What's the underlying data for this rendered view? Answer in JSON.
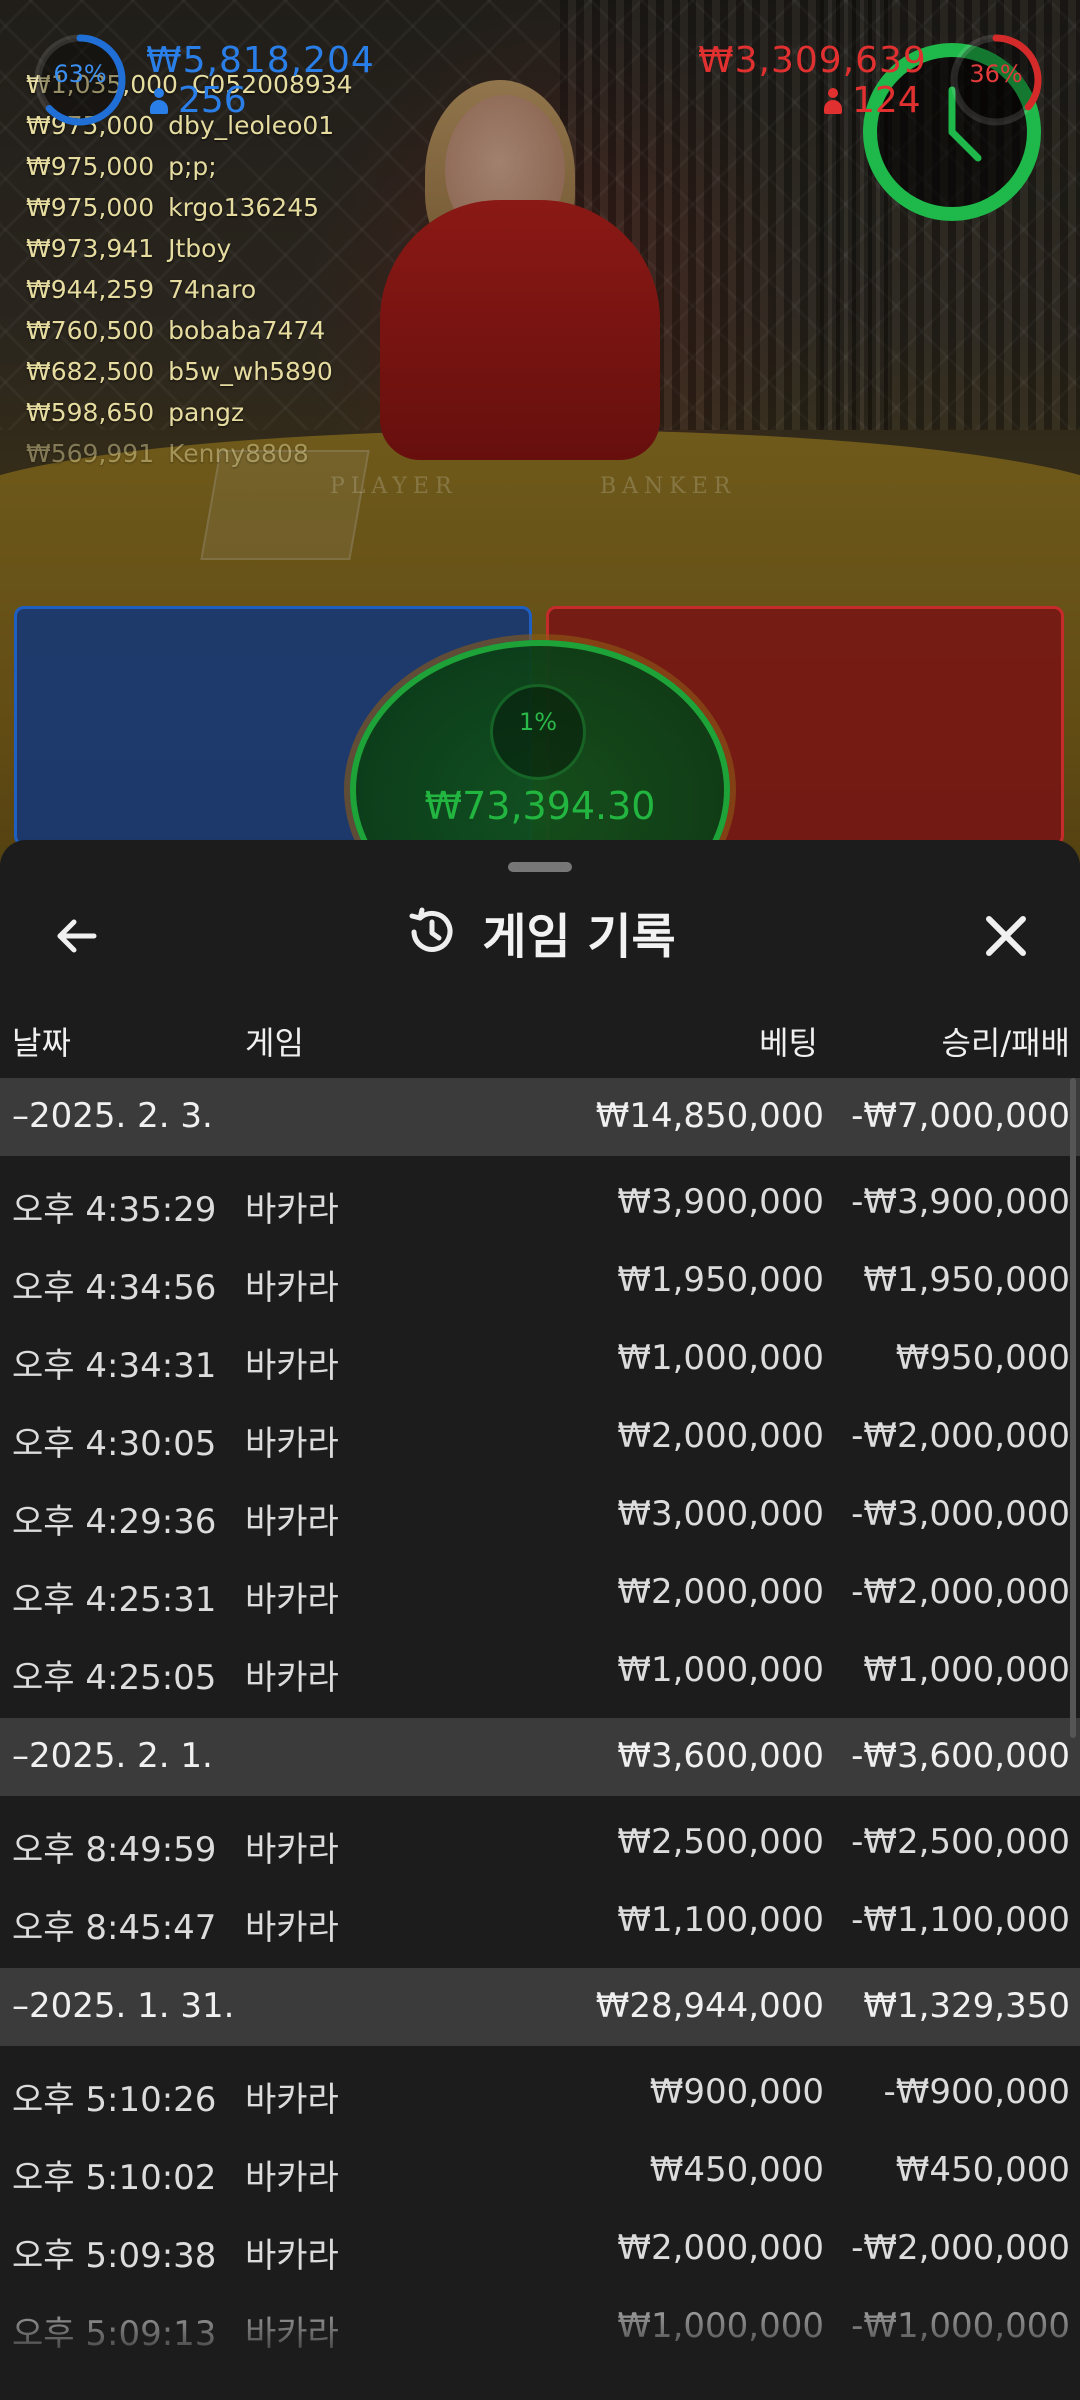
{
  "leaderboard": [
    {
      "amount": "₩1,035,000",
      "user": "C052008934"
    },
    {
      "amount": "₩975,000",
      "user": "dby_leoleo01"
    },
    {
      "amount": "₩975,000",
      "user": "p;p;"
    },
    {
      "amount": "₩975,000",
      "user": "krgo136245"
    },
    {
      "amount": "₩973,941",
      "user": "Jtboy"
    },
    {
      "amount": "₩944,259",
      "user": "74naro"
    },
    {
      "amount": "₩760,500",
      "user": "bobaba7474"
    },
    {
      "amount": "₩682,500",
      "user": "b5w_wh5890"
    },
    {
      "amount": "₩598,650",
      "user": "pangz"
    },
    {
      "amount": "₩569,991",
      "user": "Kenny8808"
    }
  ],
  "table_labels": {
    "player": "PLAYER",
    "banker": "BANKER"
  },
  "bets": {
    "player": {
      "percent": "63%",
      "amount": "₩5,818,204",
      "count": "256",
      "ratio": 0.63,
      "color": "#1f6fd6"
    },
    "banker": {
      "percent": "36%",
      "amount": "₩3,309,639",
      "count": "124",
      "ratio": 0.36,
      "color": "#d42a2a"
    },
    "tie": {
      "percent": "1%",
      "amount": "₩73,394.30",
      "color": "#1ea338"
    }
  },
  "timer": {
    "icon": "clock-icon",
    "color": "#1fb84a"
  },
  "sheet": {
    "title": "게임 기록",
    "title_icon": "history-icon",
    "back_icon": "arrow-left-icon",
    "close_icon": "close-icon",
    "columns": {
      "date": "날짜",
      "game": "게임",
      "bet": "베팅",
      "winloss": "승리/패배"
    },
    "groups": [
      {
        "date": "–2025. 2. 3.",
        "bet": "₩14,850,000",
        "winloss": "-₩7,000,000",
        "items": [
          {
            "time": "오후 4:35:29",
            "game": "바카라",
            "bet": "₩3,900,000",
            "winloss": "-₩3,900,000"
          },
          {
            "time": "오후 4:34:56",
            "game": "바카라",
            "bet": "₩1,950,000",
            "winloss": "₩1,950,000"
          },
          {
            "time": "오후 4:34:31",
            "game": "바카라",
            "bet": "₩1,000,000",
            "winloss": "₩950,000"
          },
          {
            "time": "오후 4:30:05",
            "game": "바카라",
            "bet": "₩2,000,000",
            "winloss": "-₩2,000,000"
          },
          {
            "time": "오후 4:29:36",
            "game": "바카라",
            "bet": "₩3,000,000",
            "winloss": "-₩3,000,000"
          },
          {
            "time": "오후 4:25:31",
            "game": "바카라",
            "bet": "₩2,000,000",
            "winloss": "-₩2,000,000"
          },
          {
            "time": "오후 4:25:05",
            "game": "바카라",
            "bet": "₩1,000,000",
            "winloss": "₩1,000,000"
          }
        ]
      },
      {
        "date": "–2025. 2. 1.",
        "bet": "₩3,600,000",
        "winloss": "-₩3,600,000",
        "items": [
          {
            "time": "오후 8:49:59",
            "game": "바카라",
            "bet": "₩2,500,000",
            "winloss": "-₩2,500,000"
          },
          {
            "time": "오후 8:45:47",
            "game": "바카라",
            "bet": "₩1,100,000",
            "winloss": "-₩1,100,000"
          }
        ]
      },
      {
        "date": "–2025. 1. 31.",
        "bet": "₩28,944,000",
        "winloss": "₩1,329,350",
        "items": [
          {
            "time": "오후 5:10:26",
            "game": "바카라",
            "bet": "₩900,000",
            "winloss": "-₩900,000"
          },
          {
            "time": "오후 5:10:02",
            "game": "바카라",
            "bet": "₩450,000",
            "winloss": "₩450,000"
          },
          {
            "time": "오후 5:09:38",
            "game": "바카라",
            "bet": "₩2,000,000",
            "winloss": "-₩2,000,000"
          },
          {
            "time": "오후 5:09:13",
            "game": "바카라",
            "bet": "₩1,000,000",
            "winloss": "-₩1,000,000"
          }
        ]
      }
    ]
  }
}
